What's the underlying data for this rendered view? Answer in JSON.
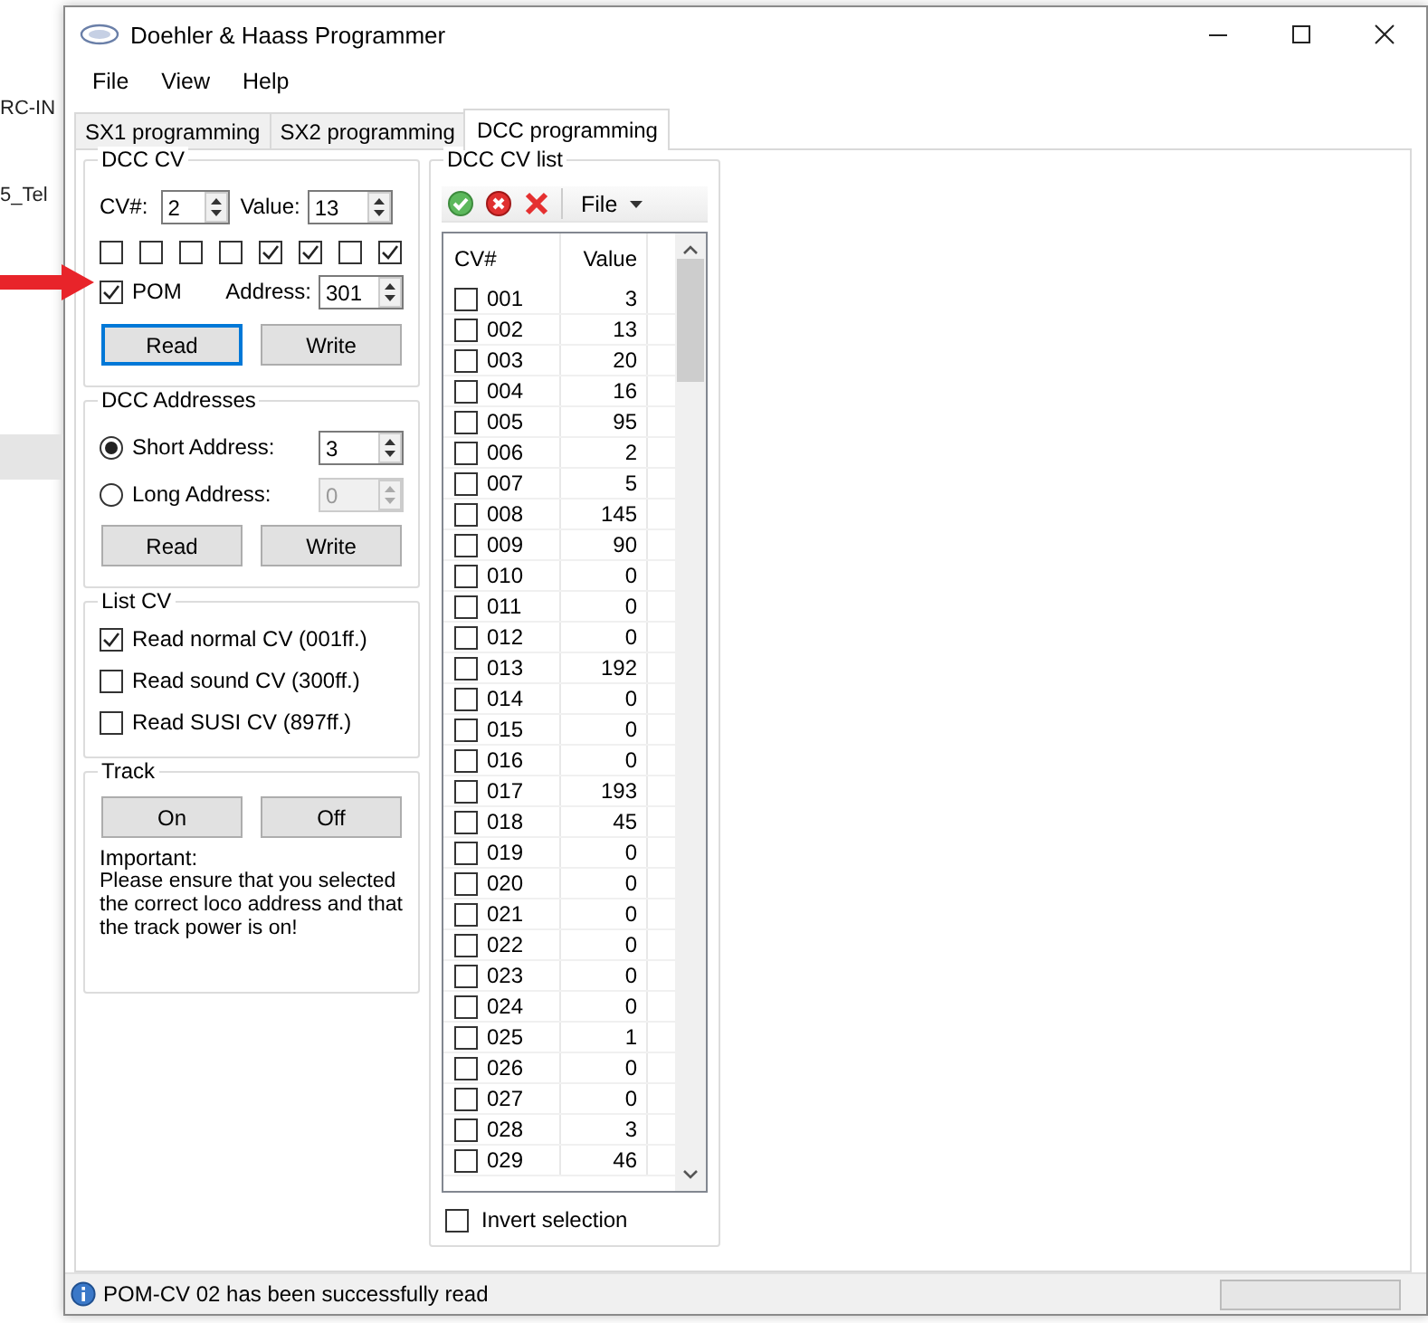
{
  "desktop": {
    "texts": [
      "RC-IN",
      "5_Tel"
    ]
  },
  "window": {
    "title": "Doehler & Haass Programmer"
  },
  "menu": [
    "File",
    "View",
    "Help"
  ],
  "tabs": [
    {
      "label": "SX1 programming",
      "selected": false
    },
    {
      "label": "SX2 programming",
      "selected": false
    },
    {
      "label": "DCC programming",
      "selected": true
    }
  ],
  "dcc_cv": {
    "title": "DCC CV",
    "cv_label": "CV#:",
    "cv_value": "2",
    "value_label": "Value:",
    "value": "13",
    "bits": [
      {
        "checked": false
      },
      {
        "checked": false
      },
      {
        "checked": false
      },
      {
        "checked": false
      },
      {
        "checked": true
      },
      {
        "checked": true
      },
      {
        "checked": false
      },
      {
        "checked": true
      }
    ],
    "pom": {
      "label": "POM",
      "checked": true
    },
    "address_label": "Address:",
    "address": "301",
    "buttons": [
      {
        "label": "Read",
        "focused": true
      },
      {
        "label": "Write",
        "focused": false
      }
    ]
  },
  "dcc_addresses": {
    "title": "DCC Addresses",
    "options": [
      {
        "label": "Short Address:",
        "selected": true,
        "value": "3",
        "disabled": false
      },
      {
        "label": "Long Address:",
        "selected": false,
        "value": "0",
        "disabled": true
      }
    ],
    "buttons": [
      "Read",
      "Write"
    ]
  },
  "list_cv": {
    "title": "List CV",
    "options": [
      {
        "label": "Read normal CV (001ff.)",
        "checked": true
      },
      {
        "label": "Read sound CV (300ff.)",
        "checked": false
      },
      {
        "label": "Read SUSI CV (897ff.)",
        "checked": false
      }
    ]
  },
  "track": {
    "title": "Track",
    "buttons": [
      "On",
      "Off"
    ],
    "note_title": "Important:",
    "note": "Please ensure that you selected the correct loco address and that the track power is on!"
  },
  "cv_list": {
    "title": "DCC CV list",
    "file_menu": "File",
    "columns": [
      "CV#",
      "Value"
    ],
    "rows": [
      {
        "cv": "001",
        "value": "3",
        "checked": false
      },
      {
        "cv": "002",
        "value": "13",
        "checked": false
      },
      {
        "cv": "003",
        "value": "20",
        "checked": false
      },
      {
        "cv": "004",
        "value": "16",
        "checked": false
      },
      {
        "cv": "005",
        "value": "95",
        "checked": false
      },
      {
        "cv": "006",
        "value": "2",
        "checked": false
      },
      {
        "cv": "007",
        "value": "5",
        "checked": false
      },
      {
        "cv": "008",
        "value": "145",
        "checked": false
      },
      {
        "cv": "009",
        "value": "90",
        "checked": false
      },
      {
        "cv": "010",
        "value": "0",
        "checked": false
      },
      {
        "cv": "011",
        "value": "0",
        "checked": false
      },
      {
        "cv": "012",
        "value": "0",
        "checked": false
      },
      {
        "cv": "013",
        "value": "192",
        "checked": false
      },
      {
        "cv": "014",
        "value": "0",
        "checked": false
      },
      {
        "cv": "015",
        "value": "0",
        "checked": false
      },
      {
        "cv": "016",
        "value": "0",
        "checked": false
      },
      {
        "cv": "017",
        "value": "193",
        "checked": false
      },
      {
        "cv": "018",
        "value": "45",
        "checked": false
      },
      {
        "cv": "019",
        "value": "0",
        "checked": false
      },
      {
        "cv": "020",
        "value": "0",
        "checked": false
      },
      {
        "cv": "021",
        "value": "0",
        "checked": false
      },
      {
        "cv": "022",
        "value": "0",
        "checked": false
      },
      {
        "cv": "023",
        "value": "0",
        "checked": false
      },
      {
        "cv": "024",
        "value": "0",
        "checked": false
      },
      {
        "cv": "025",
        "value": "1",
        "checked": false
      },
      {
        "cv": "026",
        "value": "0",
        "checked": false
      },
      {
        "cv": "027",
        "value": "0",
        "checked": false
      },
      {
        "cv": "028",
        "value": "3",
        "checked": false
      },
      {
        "cv": "029",
        "value": "46",
        "checked": false
      }
    ],
    "invert": {
      "label": "Invert selection",
      "checked": false
    }
  },
  "status_bar": {
    "message": "POM-CV 02 has been successfully read",
    "progress": {
      "level": 0
    }
  }
}
